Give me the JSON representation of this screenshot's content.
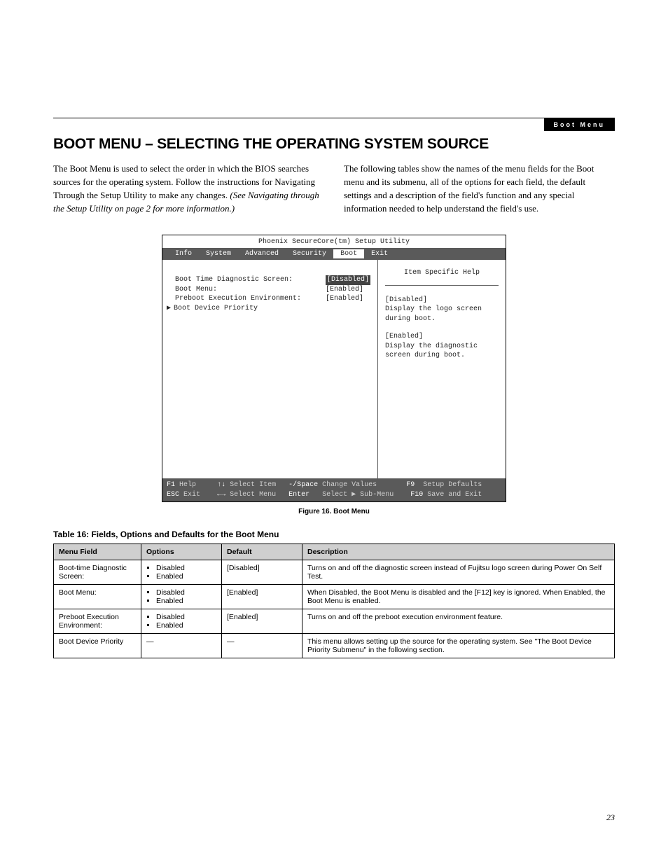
{
  "header": {
    "tag": "Boot Menu"
  },
  "title": "BOOT MENU – SELECTING THE OPERATING SYSTEM SOURCE",
  "intro": {
    "left_plain": "The Boot Menu is used to select the order in which the BIOS searches sources for the operating system. Follow the instructions for Navigating Through the Setup Utility to make any changes. ",
    "left_italic": "(See Navigating through the Setup Utility on page 2 for more information.)",
    "right": "The following tables show the names of the menu fields for the Boot menu and its submenu, all of the options for each field, the default settings and a description of the field's function and any special information needed to help understand the field's use."
  },
  "bios": {
    "title": "Phoenix SecureCore(tm) Setup Utility",
    "tabs": [
      "Info",
      "System",
      "Advanced",
      "Security",
      "Boot",
      "Exit"
    ],
    "selected_tab": "Boot",
    "rows": [
      {
        "label": "Boot Time Diagnostic Screen:",
        "value": "[Disabled]",
        "selected": true
      },
      {
        "label": "Boot Menu:",
        "value": "[Enabled]",
        "selected": false
      },
      {
        "label": "Preboot Execution Environment:",
        "value": "[Enabled]",
        "selected": false
      }
    ],
    "submenu": "Boot Device Priority",
    "help": {
      "title": "Item Specific Help",
      "p1a": "[Disabled]",
      "p1b": "Display the logo screen during boot.",
      "p2a": "[Enabled]",
      "p2b": "Display the diagnostic screen during boot."
    },
    "foot": {
      "l1": {
        "k1": "F1",
        "t1": "Help",
        "k2": "↑↓",
        "t2": "Select Item",
        "k3": "-/Space",
        "t3": "Change Values",
        "k4": "F9",
        "t4": "Setup Defaults"
      },
      "l2": {
        "k1": "ESC",
        "t1": "Exit",
        "k2": "←→",
        "t2": "Select Menu",
        "k3": "Enter",
        "t3": "Select ▶ Sub-Menu",
        "k4": "F10",
        "t4": "Save and Exit"
      }
    }
  },
  "figure_caption": "Figure 16.  Boot Menu",
  "table_title": "Table 16: Fields, Options and Defaults for the Boot Menu",
  "table": {
    "headers": [
      "Menu Field",
      "Options",
      "Default",
      "Description"
    ],
    "rows": [
      {
        "field": "Boot-time Diagnostic Screen:",
        "options": [
          "Disabled",
          "Enabled"
        ],
        "default": "[Disabled]",
        "desc": "Turns on and off the diagnostic screen instead of Fujitsu logo screen during Power On Self Test."
      },
      {
        "field": "Boot Menu:",
        "options": [
          "Disabled",
          "Enabled"
        ],
        "default": "[Enabled]",
        "desc": "When Disabled, the Boot Menu is disabled and the [F12] key is ignored. When Enabled, the Boot Menu is enabled."
      },
      {
        "field": "Preboot Execution Environment:",
        "options": [
          "Disabled",
          "Enabled"
        ],
        "default": "[Enabled]",
        "desc": "Turns on and off the preboot execution environment feature."
      },
      {
        "field": "Boot Device Priority",
        "options": [],
        "default": "—",
        "desc": "This menu allows setting up the source for the operating system. See \"The Boot Device Priority Submenu\" in the following section."
      }
    ]
  },
  "page_number": "23"
}
